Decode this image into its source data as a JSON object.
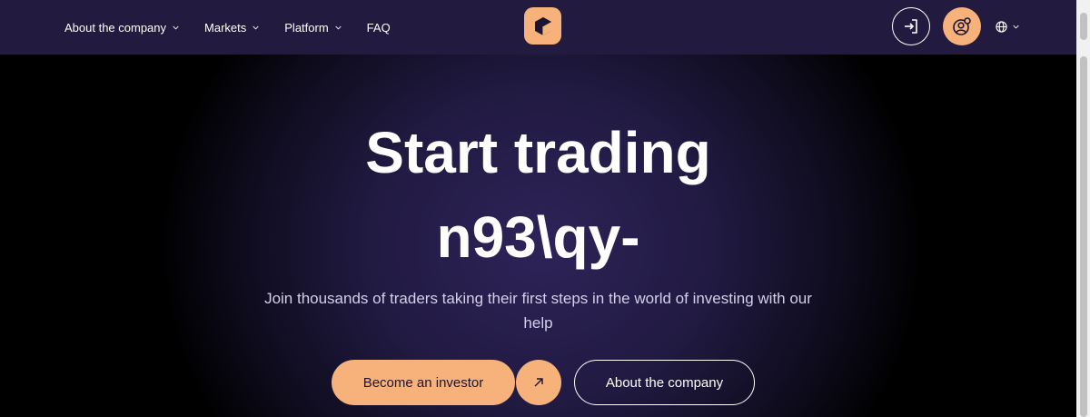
{
  "colors": {
    "header_bg": "#231a3f",
    "accent": "#f7b27b",
    "hero_glow": "#2e2358",
    "text": "#ffffff",
    "subtext": "#d3d0e8"
  },
  "nav": {
    "items": [
      {
        "label": "About the company",
        "icon": "chevron-down-icon"
      },
      {
        "label": "Markets",
        "icon": "chevron-down-icon"
      },
      {
        "label": "Platform",
        "icon": "chevron-down-icon"
      },
      {
        "label": "FAQ"
      }
    ]
  },
  "header": {
    "logo_icon": "cube-logo-icon",
    "login_icon": "login-icon",
    "user_icon": "user-settings-icon",
    "lang_icon": "globe-icon"
  },
  "hero": {
    "title_line1": "Start trading",
    "title_line2": "n93\\qy-",
    "subtitle": "Join thousands of traders taking their first steps in the world of investing with our help",
    "primary_button": "Become an investor",
    "arrow_icon": "arrow-up-right-icon",
    "secondary_button": "About the company"
  }
}
